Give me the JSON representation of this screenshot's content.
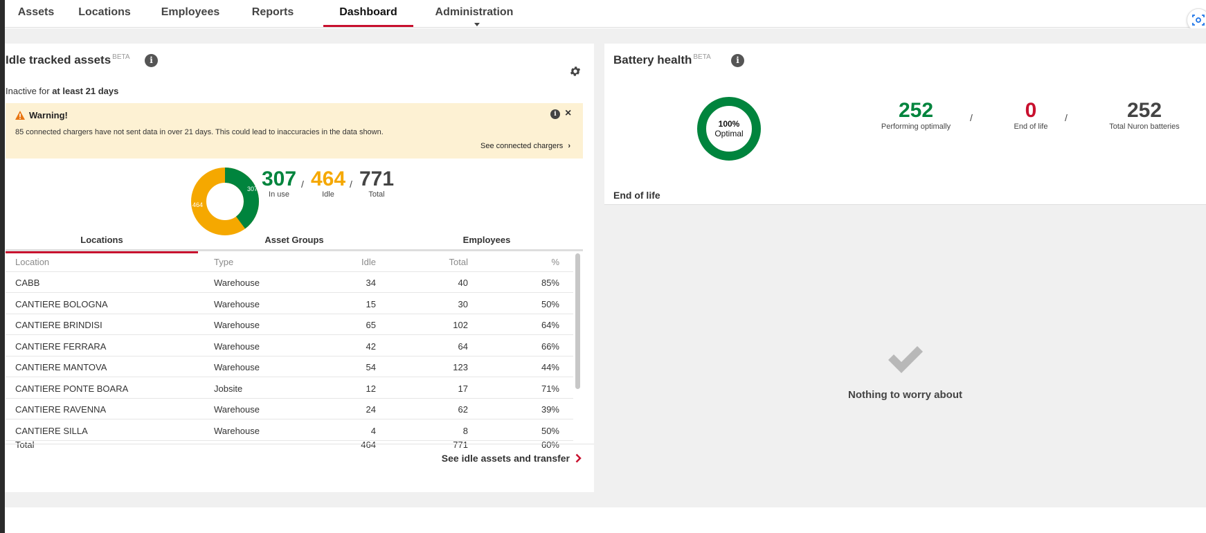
{
  "nav": {
    "items": [
      {
        "label": "Assets"
      },
      {
        "label": "Locations"
      },
      {
        "label": "Employees"
      },
      {
        "label": "Reports"
      },
      {
        "label": "Dashboard"
      },
      {
        "label": "Administration"
      }
    ],
    "active": "Dashboard"
  },
  "idle": {
    "title": "Idle tracked assets",
    "beta": "BETA",
    "subtitle_prefix": "Inactive for ",
    "subtitle_bold": "at least 21 days",
    "warning": {
      "title": "Warning!",
      "text": "85 connected chargers have not sent data in over 21 days. This could lead to inaccuracies in the data shown.",
      "link": "See connected chargers"
    },
    "donut": {
      "in_use_label": "307",
      "idle_label": "464",
      "in_use_value": 307,
      "idle_value": 464,
      "in_use_color": "#00843d",
      "idle_color": "#f5a800"
    },
    "stats": {
      "in_use": {
        "value": "307",
        "label": "In use"
      },
      "idle": {
        "value": "464",
        "label": "Idle"
      },
      "total": {
        "value": "771",
        "label": "Total"
      },
      "slash": "/"
    },
    "tabs": [
      {
        "label": "Locations"
      },
      {
        "label": "Asset Groups"
      },
      {
        "label": "Employees"
      }
    ],
    "table": {
      "headers": {
        "location": "Location",
        "type": "Type",
        "idle": "Idle",
        "total": "Total",
        "pct": "%"
      },
      "rows": [
        {
          "location": "CABB",
          "type": "Warehouse",
          "idle": "34",
          "total": "40",
          "pct": "85%"
        },
        {
          "location": "CANTIERE BOLOGNA",
          "type": "Warehouse",
          "idle": "15",
          "total": "30",
          "pct": "50%"
        },
        {
          "location": "CANTIERE BRINDISI",
          "type": "Warehouse",
          "idle": "65",
          "total": "102",
          "pct": "64%"
        },
        {
          "location": "CANTIERE FERRARA",
          "type": "Warehouse",
          "idle": "42",
          "total": "64",
          "pct": "66%"
        },
        {
          "location": "CANTIERE MANTOVA",
          "type": "Warehouse",
          "idle": "54",
          "total": "123",
          "pct": "44%"
        },
        {
          "location": "CANTIERE PONTE BOARA",
          "type": "Jobsite",
          "idle": "12",
          "total": "17",
          "pct": "71%"
        },
        {
          "location": "CANTIERE RAVENNA",
          "type": "Warehouse",
          "idle": "24",
          "total": "62",
          "pct": "39%"
        },
        {
          "location": "CANTIERE SILLA",
          "type": "Warehouse",
          "idle": "4",
          "total": "8",
          "pct": "50%"
        }
      ],
      "total": {
        "label": "Total",
        "idle": "464",
        "total": "771",
        "pct": "60%"
      }
    },
    "footer_link": "See idle assets and transfer"
  },
  "battery": {
    "title": "Battery health",
    "beta": "BETA",
    "donut": {
      "pct": "100%",
      "label": "Optimal",
      "color": "#00843d",
      "fraction": 1.0
    },
    "stats": {
      "optimal": {
        "value": "252",
        "label": "Performing optimally",
        "color": "#00843d"
      },
      "eol": {
        "value": "0",
        "label": "End of life",
        "color": "#c8102e"
      },
      "total": {
        "value": "252",
        "label": "Total Nuron batteries",
        "color": "#444444"
      },
      "slash": "/"
    },
    "eol_title": "End of life",
    "ok_text": "Nothing to worry about"
  }
}
